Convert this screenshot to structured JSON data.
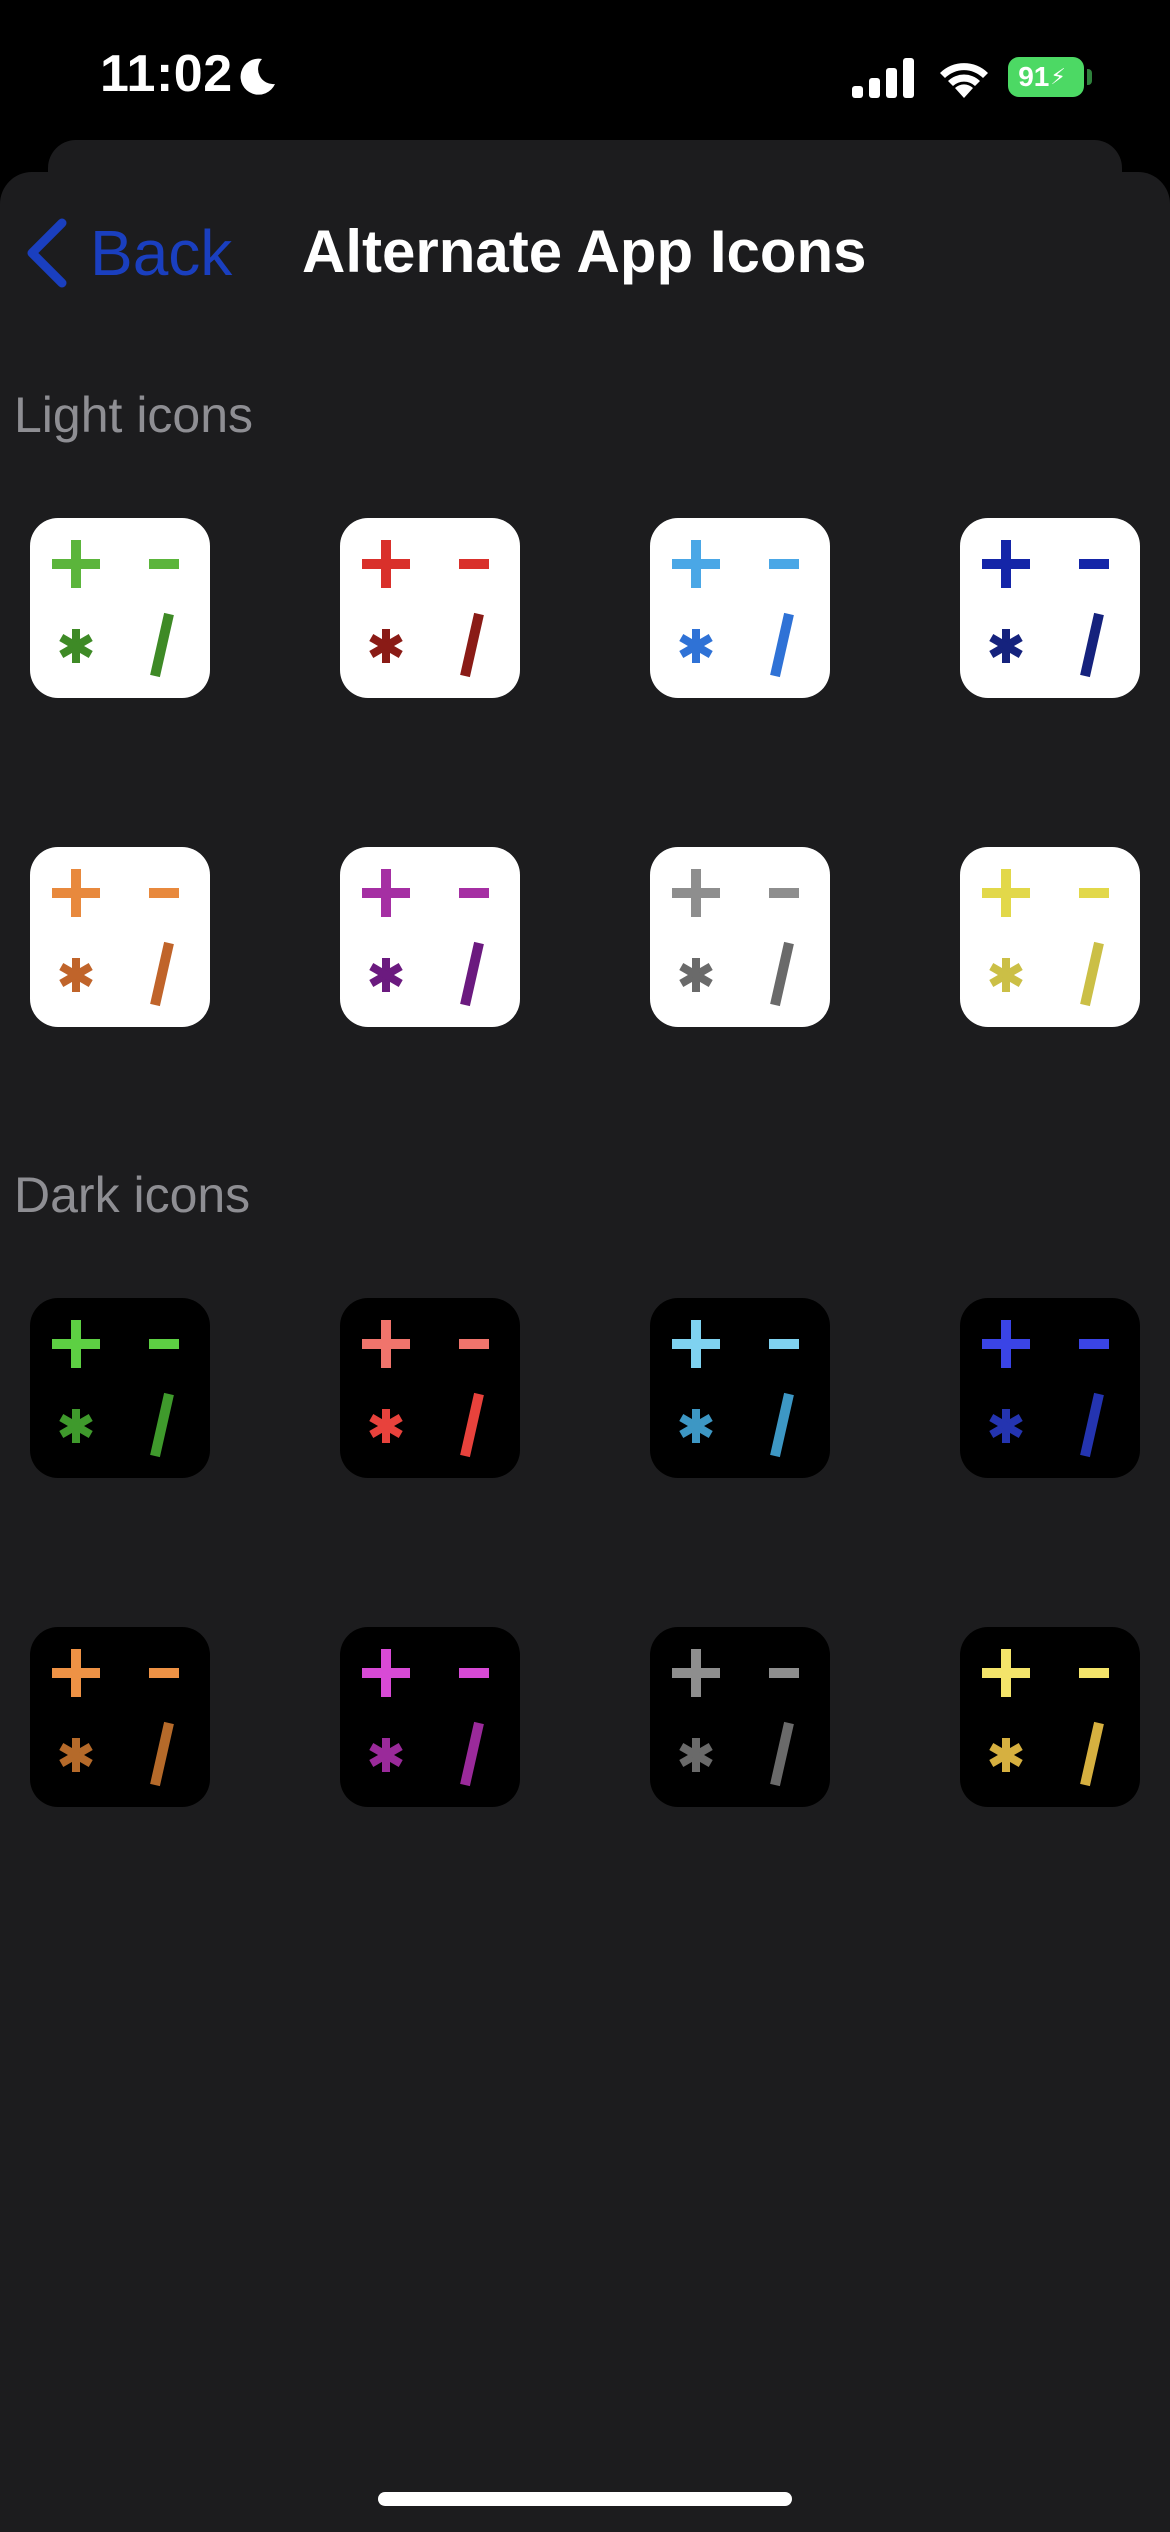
{
  "status_bar": {
    "time": "11:02",
    "battery": "91",
    "icons": [
      "moon-icon",
      "cellular-signal-icon",
      "wifi-icon",
      "battery-charging-icon"
    ]
  },
  "nav": {
    "back_label": "Back",
    "title": "Alternate App Icons",
    "back_color": "#1a3fbf"
  },
  "sections": [
    {
      "title": "Light icons",
      "background": "#ffffff",
      "icons": [
        {
          "name": "green",
          "top": "#5bb53b",
          "bottom": "#3e8a26"
        },
        {
          "name": "red",
          "top": "#d9302b",
          "bottom": "#8a1b16"
        },
        {
          "name": "blue",
          "top": "#4aa7e6",
          "bottom": "#2f72d6"
        },
        {
          "name": "navy",
          "top": "#1425a8",
          "bottom": "#15227d"
        },
        {
          "name": "orange",
          "top": "#e8893d",
          "bottom": "#c0642a"
        },
        {
          "name": "purple",
          "top": "#a52fa3",
          "bottom": "#6b1a7f"
        },
        {
          "name": "gray",
          "top": "#8e8e8e",
          "bottom": "#6a6a6a"
        },
        {
          "name": "yellow",
          "top": "#e2d84a",
          "bottom": "#cbbf46"
        }
      ]
    },
    {
      "title": "Dark icons",
      "background": "#000000",
      "icons": [
        {
          "name": "green",
          "top": "#5dd043",
          "bottom": "#3f9a2c"
        },
        {
          "name": "red",
          "top": "#f0746c",
          "bottom": "#e8423c"
        },
        {
          "name": "blue",
          "top": "#7fd2f0",
          "bottom": "#3d97c4"
        },
        {
          "name": "navy",
          "top": "#3a44e6",
          "bottom": "#2434b0"
        },
        {
          "name": "orange",
          "top": "#ee9245",
          "bottom": "#b56a2a"
        },
        {
          "name": "purple",
          "top": "#d84ad6",
          "bottom": "#9a2a9a"
        },
        {
          "name": "gray",
          "top": "#8e8e8e",
          "bottom": "#6a6a6a"
        },
        {
          "name": "yellow",
          "top": "#f4e46a",
          "bottom": "#d6b040"
        }
      ]
    }
  ]
}
